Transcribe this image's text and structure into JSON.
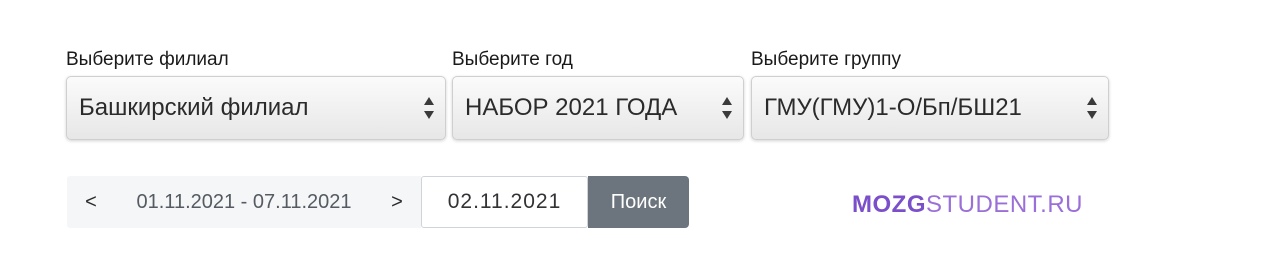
{
  "filters": {
    "branch": {
      "label": "Выберите филиал",
      "selected": "Башкирский филиал"
    },
    "year": {
      "label": "Выберите год",
      "selected": "НАБОР 2021 ГОДА"
    },
    "group": {
      "label": "Выберите группу",
      "selected": "ГМУ(ГМУ)1-О/Бп/БШ21"
    }
  },
  "week_nav": {
    "prev_label": "<",
    "range": "01.11.2021 - 07.11.2021",
    "next_label": ">",
    "date_value": "02.11.2021",
    "search_label": "Поиск"
  },
  "watermark": {
    "bold_part": "MOZG",
    "light_part": "STUDENT.RU",
    "colors": {
      "bold": "#7b4fc9",
      "light": "#9a6fd8"
    }
  },
  "icons": {
    "select_arrows": "up-down-chevron-icon"
  }
}
